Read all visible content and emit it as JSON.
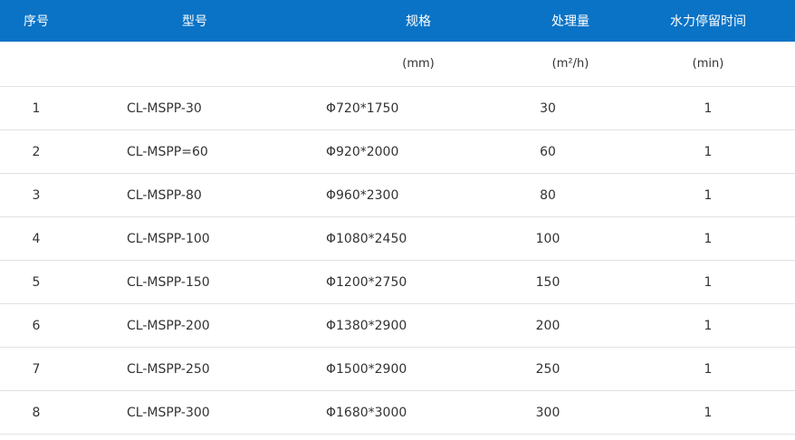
{
  "headers": [
    "序号",
    "型号",
    "规格",
    "处理量",
    "水力停留时间"
  ],
  "units": [
    "",
    "",
    "(mm)",
    "(m²/h)",
    "(min)"
  ],
  "rows": [
    [
      "1",
      "CL-MSPP-30",
      "Φ720*1750",
      "30",
      "1"
    ],
    [
      "2",
      "CL-MSPP=60",
      "Φ920*2000",
      "60",
      "1"
    ],
    [
      "3",
      "CL-MSPP-80",
      "Φ960*2300",
      "80",
      "1"
    ],
    [
      "4",
      "CL-MSPP-100",
      "Φ1080*2450",
      "100",
      "1"
    ],
    [
      "5",
      "CL-MSPP-150",
      "Φ1200*2750",
      "150",
      "1"
    ],
    [
      "6",
      "CL-MSPP-200",
      "Φ1380*2900",
      "200",
      "1"
    ],
    [
      "7",
      "CL-MSPP-250",
      "Φ1500*2900",
      "250",
      "1"
    ],
    [
      "8",
      "CL-MSPP-300",
      "Φ1680*3000",
      "300",
      "1"
    ]
  ],
  "colors": {
    "header_bg": "#0a73c6",
    "header_text": "#ffffff",
    "row_border": "#e1e1e1"
  }
}
